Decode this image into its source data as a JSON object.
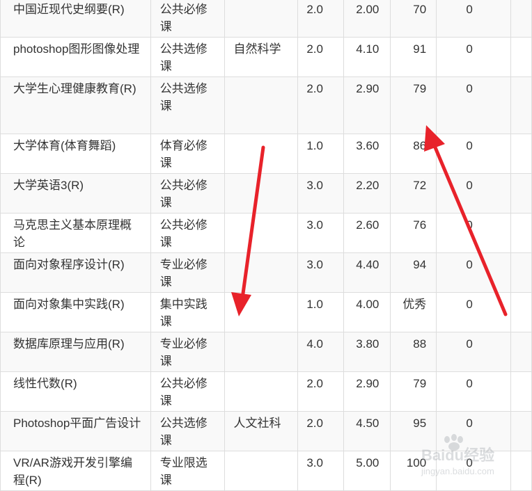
{
  "table": {
    "rows": [
      {
        "course": "中国近现代史纲要(R)",
        "type": "公共必修课",
        "category": "",
        "credit": "2.0",
        "gpa": "2.00",
        "score": "70",
        "other": "0"
      },
      {
        "course": "photoshop图形图像处理",
        "type": "公共选修课",
        "category": "自然科学",
        "credit": "2.0",
        "gpa": "4.10",
        "score": "91",
        "other": "0"
      },
      {
        "course": "大学生心理健康教育(R)",
        "type": "公共选修课",
        "category": "",
        "credit": "2.0",
        "gpa": "2.90",
        "score": "79",
        "other": "0"
      },
      {
        "course": "大学体育(体育舞蹈)",
        "type": "体育必修课",
        "category": "",
        "credit": "1.0",
        "gpa": "3.60",
        "score": "86",
        "other": "0"
      },
      {
        "course": "大学英语3(R)",
        "type": "公共必修课",
        "category": "",
        "credit": "3.0",
        "gpa": "2.20",
        "score": "72",
        "other": "0"
      },
      {
        "course": "马克思主义基本原理概论",
        "type": "公共必修课",
        "category": "",
        "credit": "3.0",
        "gpa": "2.60",
        "score": "76",
        "other": "0"
      },
      {
        "course": "面向对象程序设计(R)",
        "type": "专业必修课",
        "category": "",
        "credit": "3.0",
        "gpa": "4.40",
        "score": "94",
        "other": "0"
      },
      {
        "course": "面向对象集中实践(R)",
        "type": "集中实践课",
        "category": "",
        "credit": "1.0",
        "gpa": "4.00",
        "score": "优秀",
        "other": "0"
      },
      {
        "course": "数据库原理与应用(R)",
        "type": "专业必修课",
        "category": "",
        "credit": "4.0",
        "gpa": "3.80",
        "score": "88",
        "other": "0"
      },
      {
        "course": "线性代数(R)",
        "type": "公共必修课",
        "category": "",
        "credit": "2.0",
        "gpa": "2.90",
        "score": "79",
        "other": "0"
      },
      {
        "course": "Photoshop平面广告设计",
        "type": "公共选修课",
        "category": "人文社科",
        "credit": "2.0",
        "gpa": "4.50",
        "score": "95",
        "other": "0"
      },
      {
        "course": "VR/AR游戏开发引擎编程(R)",
        "type": "专业限选课",
        "category": "",
        "credit": "3.0",
        "gpa": "5.00",
        "score": "100",
        "other": "0"
      }
    ]
  },
  "annotations": {
    "arrow_color": "#e8222a"
  },
  "watermark": {
    "brand": "Baidu经验",
    "url": "jingyan.baidu.com",
    "icon": "paw-icon"
  }
}
